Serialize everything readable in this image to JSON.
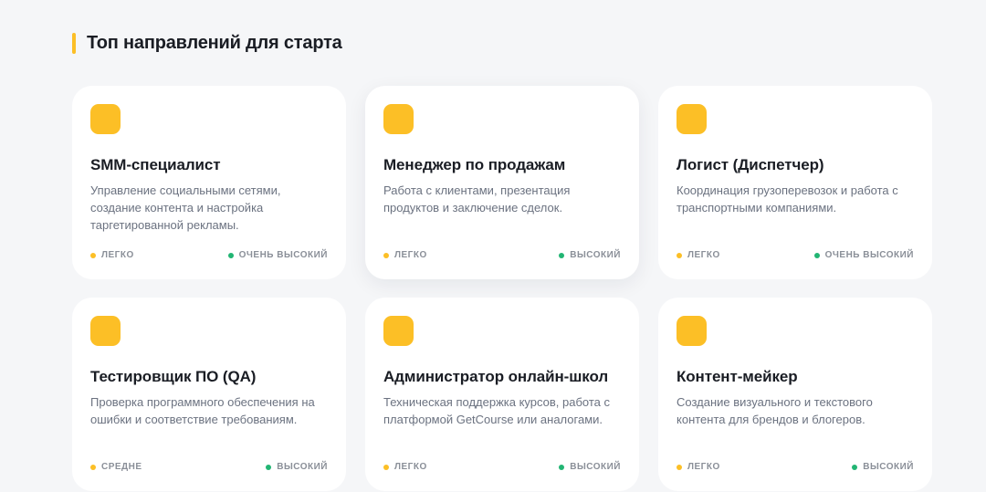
{
  "section": {
    "title": "Топ направлений для старта"
  },
  "colors": {
    "accent": "#fcbf26",
    "difficulty_dot": "#fcbf26",
    "demand_dot": "#22b573"
  },
  "cards": [
    {
      "icon": "yellow-square-icon",
      "title": "SMM-специалист",
      "description": "Управление социальными сетями, создание контента и настройка таргетированной рекламы.",
      "difficulty": "ЛЕГКО",
      "demand": "ОЧЕНЬ ВЫСОКИЙ"
    },
    {
      "icon": "yellow-square-icon",
      "title": "Менеджер по продажам",
      "description": "Работа с клиентами, презентация продуктов и заключение сделок.",
      "difficulty": "ЛЕГКО",
      "demand": "ВЫСОКИЙ"
    },
    {
      "icon": "yellow-square-icon",
      "title": "Логист (Диспетчер)",
      "description": "Координация грузоперевозок и работа с транспортными компаниями.",
      "difficulty": "ЛЕГКО",
      "demand": "ОЧЕНЬ ВЫСОКИЙ"
    },
    {
      "icon": "yellow-square-icon",
      "title": "Тестировщик ПО (QA)",
      "description": "Проверка программного обеспечения на ошибки и соответствие требованиям.",
      "difficulty": "СРЕДНЕ",
      "demand": "ВЫСОКИЙ"
    },
    {
      "icon": "yellow-square-icon",
      "title": "Администратор онлайн-школ",
      "description": "Техническая поддержка курсов, работа с платформой GetCourse или аналогами.",
      "difficulty": "ЛЕГКО",
      "demand": "ВЫСОКИЙ"
    },
    {
      "icon": "yellow-square-icon",
      "title": "Контент-мейкер",
      "description": "Создание визуального и текстового контента для брендов и блогеров.",
      "difficulty": "ЛЕГКО",
      "demand": "ВЫСОКИЙ"
    }
  ]
}
